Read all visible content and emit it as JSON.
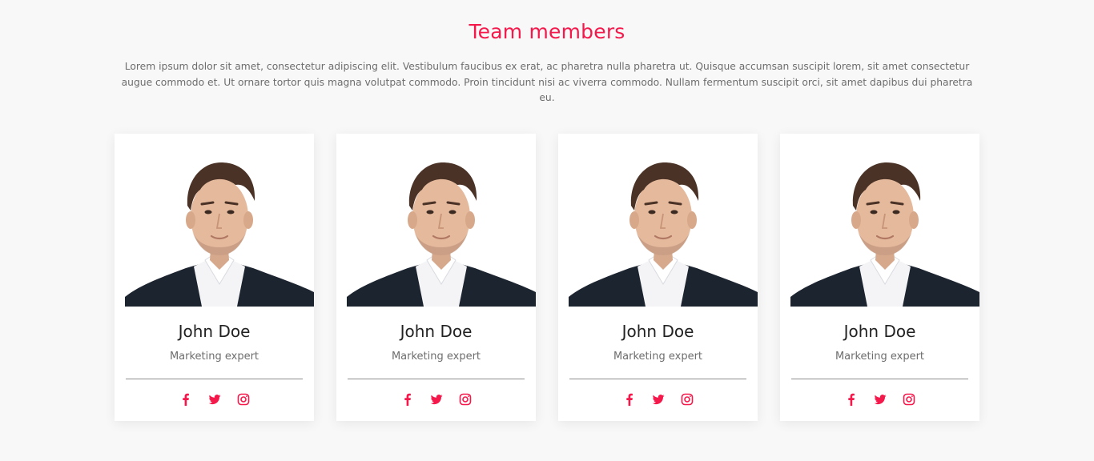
{
  "section": {
    "title": "Team members",
    "description": "Lorem ipsum dolor sit amet, consectetur adipiscing elit. Vestibulum faucibus ex erat, ac pharetra nulla pharetra ut. Quisque accumsan suscipit lorem, sit amet consectetur augue commodo et. Ut ornare tortor quis magna volutpat commodo. Proin tincidunt nisi ac viverra commodo. Nullam fermentum suscipit orci, sit amet dapibus dui pharetra eu."
  },
  "members": [
    {
      "name": "John Doe",
      "role": "Marketing expert"
    },
    {
      "name": "John Doe",
      "role": "Marketing expert"
    },
    {
      "name": "John Doe",
      "role": "Marketing expert"
    },
    {
      "name": "John Doe",
      "role": "Marketing expert"
    }
  ],
  "social_icons": [
    "facebook-icon",
    "twitter-icon",
    "instagram-icon"
  ],
  "colors": {
    "accent": "#f5184b",
    "background": "#f8f8f8",
    "card": "#ffffff",
    "text_muted": "#6d6d6d"
  }
}
